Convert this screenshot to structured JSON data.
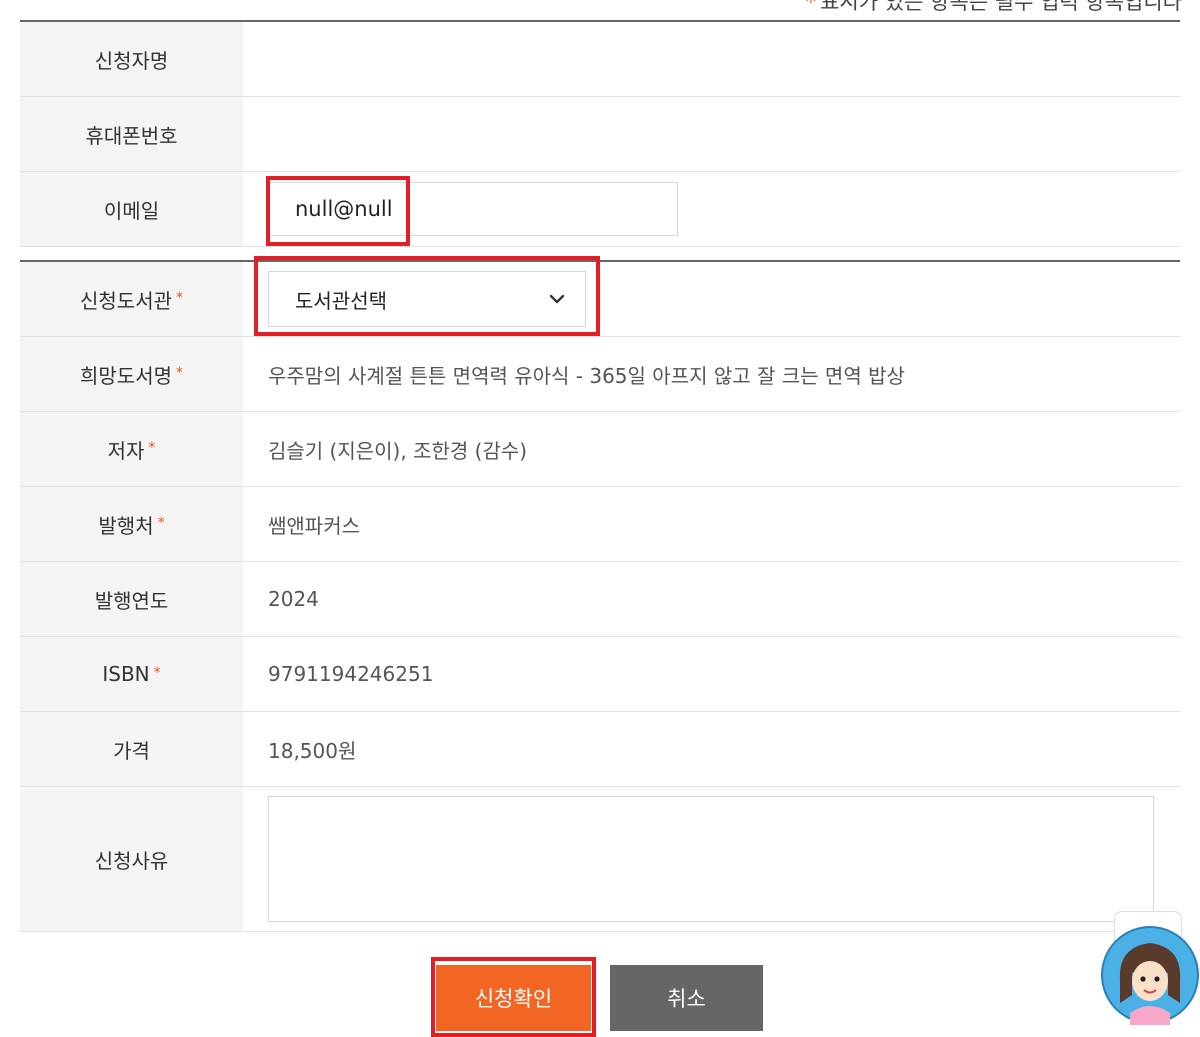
{
  "notice": {
    "star": "*",
    "text": "표시가 있는 항목은 필수 입력 항목입니다"
  },
  "required_mark": "*",
  "form": {
    "applicant_name": {
      "label": "신청자명",
      "value": ""
    },
    "phone": {
      "label": "휴대폰번호",
      "value": ""
    },
    "email": {
      "label": "이메일",
      "value": "null@null"
    },
    "library": {
      "label": "신청도서관",
      "selected": "도서관선택"
    },
    "book_title": {
      "label": "희망도서명",
      "value": "우주맘의 사계절 튼튼 면역력 유아식 - 365일 아프지 않고 잘 크는 면역 밥상"
    },
    "author": {
      "label": "저자",
      "value": "김슬기 (지은이), 조한경 (감수)"
    },
    "publisher": {
      "label": "발행처",
      "value": "쌤앤파커스"
    },
    "pub_year": {
      "label": "발행연도",
      "value": "2024"
    },
    "isbn": {
      "label": "ISBN",
      "value": "9791194246251"
    },
    "price": {
      "label": "가격",
      "value": "18,500원"
    },
    "reason": {
      "label": "신청사유",
      "value": ""
    }
  },
  "buttons": {
    "submit": "신청확인",
    "cancel": "취소"
  },
  "colors": {
    "accent": "#f26522",
    "cancel": "#666666",
    "highlight": "#e41e26",
    "required": "#e8541c",
    "label_bg": "#f4f4f4"
  },
  "icons": {
    "select_arrow": "chevron-down-icon",
    "mascot": "mascot-avatar-icon"
  }
}
